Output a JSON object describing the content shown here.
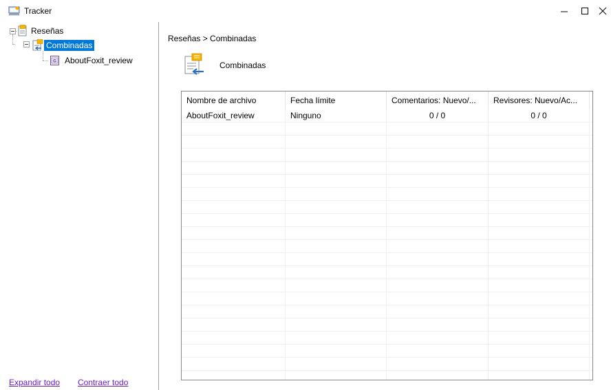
{
  "window": {
    "title": "Tracker"
  },
  "tree": {
    "root": {
      "label": "Reseñas"
    },
    "child": {
      "label": "Combinadas"
    },
    "leaf": {
      "label": "AboutFoxit_review"
    }
  },
  "footer": {
    "expand_all": "Expandir todo",
    "collapse_all": "Contraer todo"
  },
  "breadcrumb": {
    "text": "Reseñas > Combinadas"
  },
  "header": {
    "title": "Combinadas",
    "icon": "merged-review-icon"
  },
  "table": {
    "columns": [
      "Nombre de archivo",
      "Fecha límite",
      "Comentarios: Nuevo/...",
      "Revisores: Nuevo/Ac..."
    ],
    "rows": [
      {
        "name": "AboutFoxit_review",
        "deadline": "Ninguno",
        "comments": "0 / 0",
        "reviewers": "0 / 0"
      }
    ]
  },
  "colors": {
    "selection": "#0078d7",
    "link": "#6a1dc6",
    "accent_orange": "#f5b400"
  }
}
